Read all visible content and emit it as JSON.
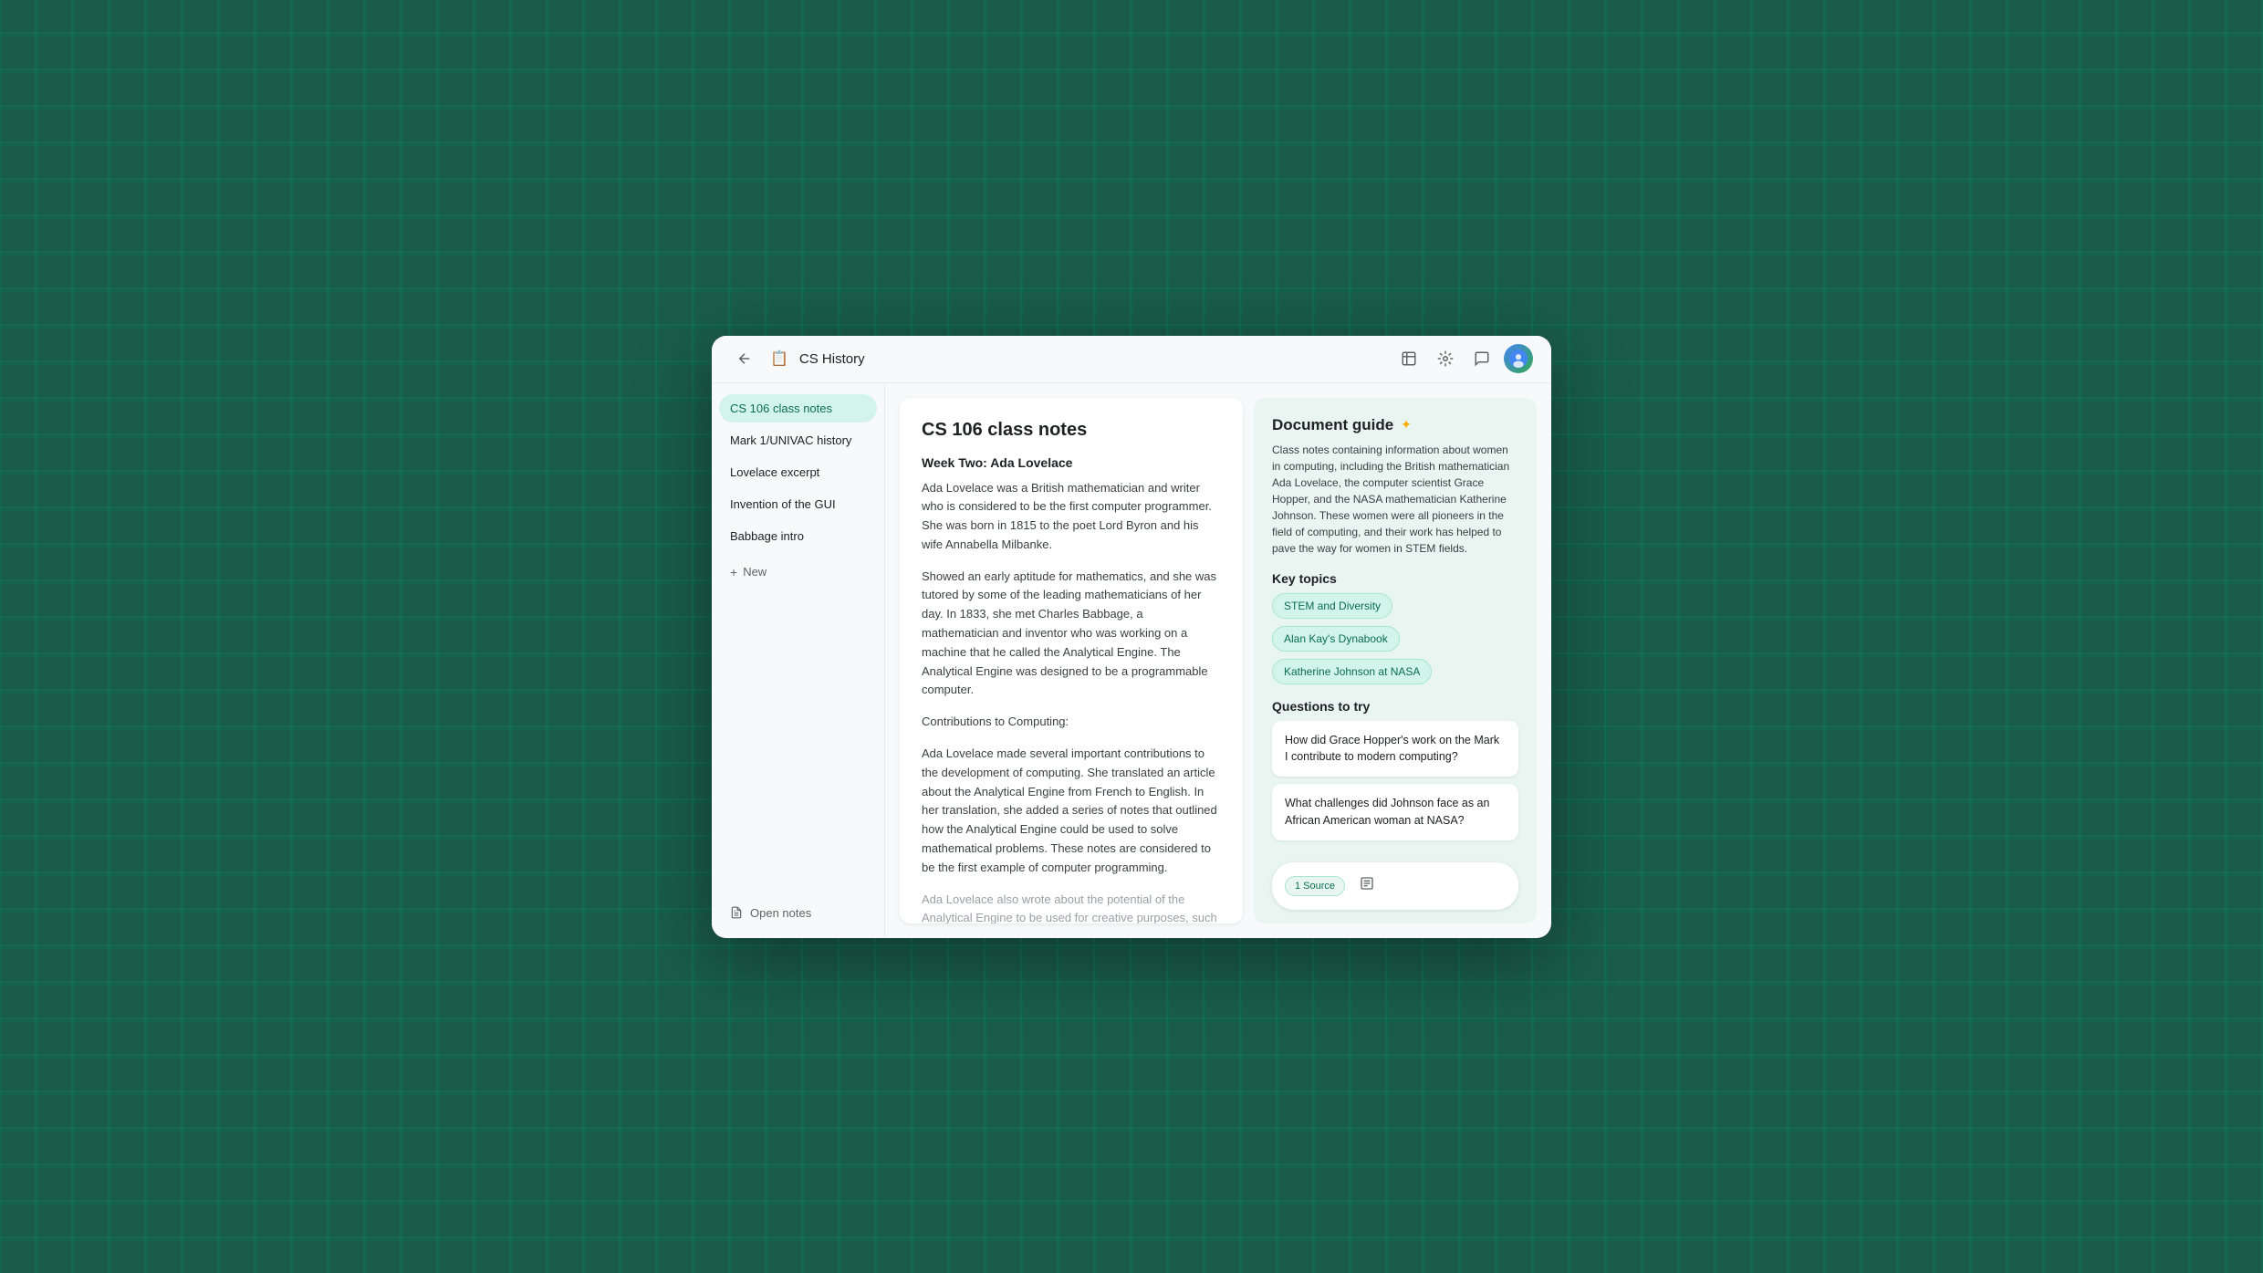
{
  "app": {
    "title": "CS History",
    "title_icon": "📋"
  },
  "sidebar": {
    "items": [
      {
        "label": "CS 106 class notes",
        "active": true
      },
      {
        "label": "Mark 1/UNIVAC history",
        "active": false
      },
      {
        "label": "Lovelace excerpt",
        "active": false
      },
      {
        "label": "Invention of the GUI",
        "active": false
      },
      {
        "label": "Babbage intro",
        "active": false
      }
    ],
    "new_label": "New",
    "open_notes_label": "Open notes"
  },
  "document": {
    "title": "CS 106 class notes",
    "week_label": "Week Two: Ada Lovelace",
    "paragraphs": [
      "Ada Lovelace was a British mathematician and writer who is considered to be the first computer programmer. She was born in 1815 to the poet Lord Byron and his wife Annabella Milbanke.",
      "Showed an early aptitude for mathematics, and she was tutored by some of the leading mathematicians of her day. In 1833, she met Charles Babbage, a mathematician and inventor who was working on a machine that he called the Analytical Engine. The Analytical Engine was designed to be a programmable computer.",
      "Contributions to Computing:",
      "Ada Lovelace made several important contributions to the development of computing. She translated an article about the Analytical Engine from French to English. In her translation, she added a series of notes that outlined how the Analytical Engine could be used to solve mathematical problems. These notes are considered to be the first example of computer programming.",
      "Ada Lovelace also wrote about the potential of the Analytical Engine to be used for creative purposes, such as composing music. She believed that the Analytical Engine would have a profound impact on society; one of the first people to envision the potential of computers to be used for more than just calculation."
    ]
  },
  "ai_panel": {
    "guide_title": "Document guide",
    "guide_description": "Class notes containing information about women in computing, including the British mathematician Ada Lovelace, the computer scientist Grace Hopper, and the NASA mathematician Katherine Johnson. These women were all pioneers in the field of computing, and their work has helped to pave the way for women in STEM fields.",
    "key_topics_title": "Key topics",
    "topics": [
      "STEM and Diversity",
      "Alan Kay's Dynabook",
      "Katherine Johnson at NASA"
    ],
    "questions_title": "Questions to try",
    "questions": [
      "How did Grace Hopper's work on the Mark I contribute to modern computing?",
      "What challenges did Johnson face as an African American woman at NASA?"
    ],
    "input": {
      "source_label": "1 Source",
      "placeholder": "",
      "send_label": "↑"
    }
  },
  "toolbar": {
    "icons": [
      {
        "name": "bookmark-icon",
        "symbol": "🔖"
      },
      {
        "name": "settings-icon",
        "symbol": "⚙"
      },
      {
        "name": "chat-icon",
        "symbol": "💬"
      }
    ]
  }
}
